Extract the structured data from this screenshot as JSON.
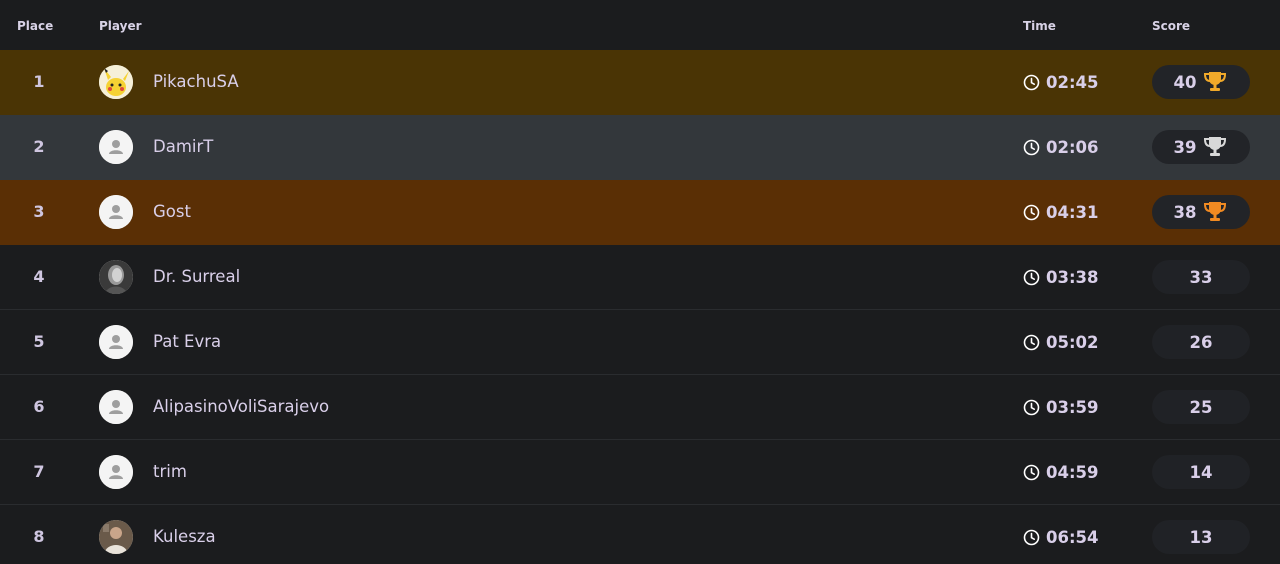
{
  "header": {
    "place": "Place",
    "player": "Player",
    "time": "Time",
    "score": "Score"
  },
  "colors": {
    "gold_row": "#4a3405",
    "silver_row": "#33373b",
    "bronze_row": "#5a2f05",
    "gold_trophy": "#f0a92a",
    "silver_trophy": "#d8d8d8",
    "bronze_trophy": "#f08a22"
  },
  "rows": [
    {
      "place": "1",
      "player": "PikachuSA",
      "time": "02:45",
      "score": "40",
      "avatar": "pikachu-avatar",
      "trophy": "gold"
    },
    {
      "place": "2",
      "player": "DamirT",
      "time": "02:06",
      "score": "39",
      "avatar": "default-user-avatar",
      "trophy": "silver"
    },
    {
      "place": "3",
      "player": "Gost",
      "time": "04:31",
      "score": "38",
      "avatar": "default-user-avatar",
      "trophy": "bronze"
    },
    {
      "place": "4",
      "player": "Dr. Surreal",
      "time": "03:38",
      "score": "33",
      "avatar": "photo-avatar",
      "trophy": ""
    },
    {
      "place": "5",
      "player": "Pat Evra",
      "time": "05:02",
      "score": "26",
      "avatar": "default-user-avatar",
      "trophy": ""
    },
    {
      "place": "6",
      "player": "AlipasinoVoliSarajevo",
      "time": "03:59",
      "score": "25",
      "avatar": "default-user-avatar",
      "trophy": ""
    },
    {
      "place": "7",
      "player": "trim",
      "time": "04:59",
      "score": "14",
      "avatar": "default-user-avatar",
      "trophy": ""
    },
    {
      "place": "8",
      "player": "Kulesza",
      "time": "06:54",
      "score": "13",
      "avatar": "photo-avatar",
      "trophy": ""
    }
  ]
}
